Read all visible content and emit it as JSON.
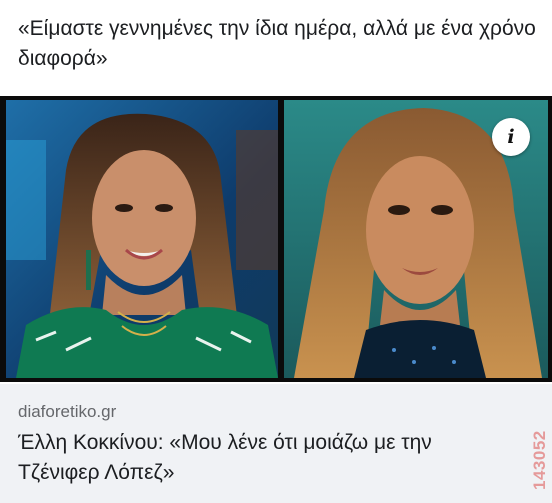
{
  "post": {
    "caption": "«Είμαστε γεννημένες την ίδια ημέρα, αλλά με ένα χρόνο διαφορά»"
  },
  "media": {
    "info_icon": "info-icon",
    "info_glyph": "i",
    "left_photo": "left-portrait-photo",
    "right_photo": "right-portrait-photo"
  },
  "link_preview": {
    "domain": "diaforetiko.gr",
    "title": "Έλλη Κοκκίνου: «Μου λένε ότι μοιάζω με την Τζένιφερ Λόπεζ»"
  },
  "watermark": "143052",
  "colors": {
    "caption_text": "#1c1e21",
    "domain_text": "#65676b",
    "preview_bg": "#f0f2f5",
    "watermark": "#e59a9a"
  }
}
